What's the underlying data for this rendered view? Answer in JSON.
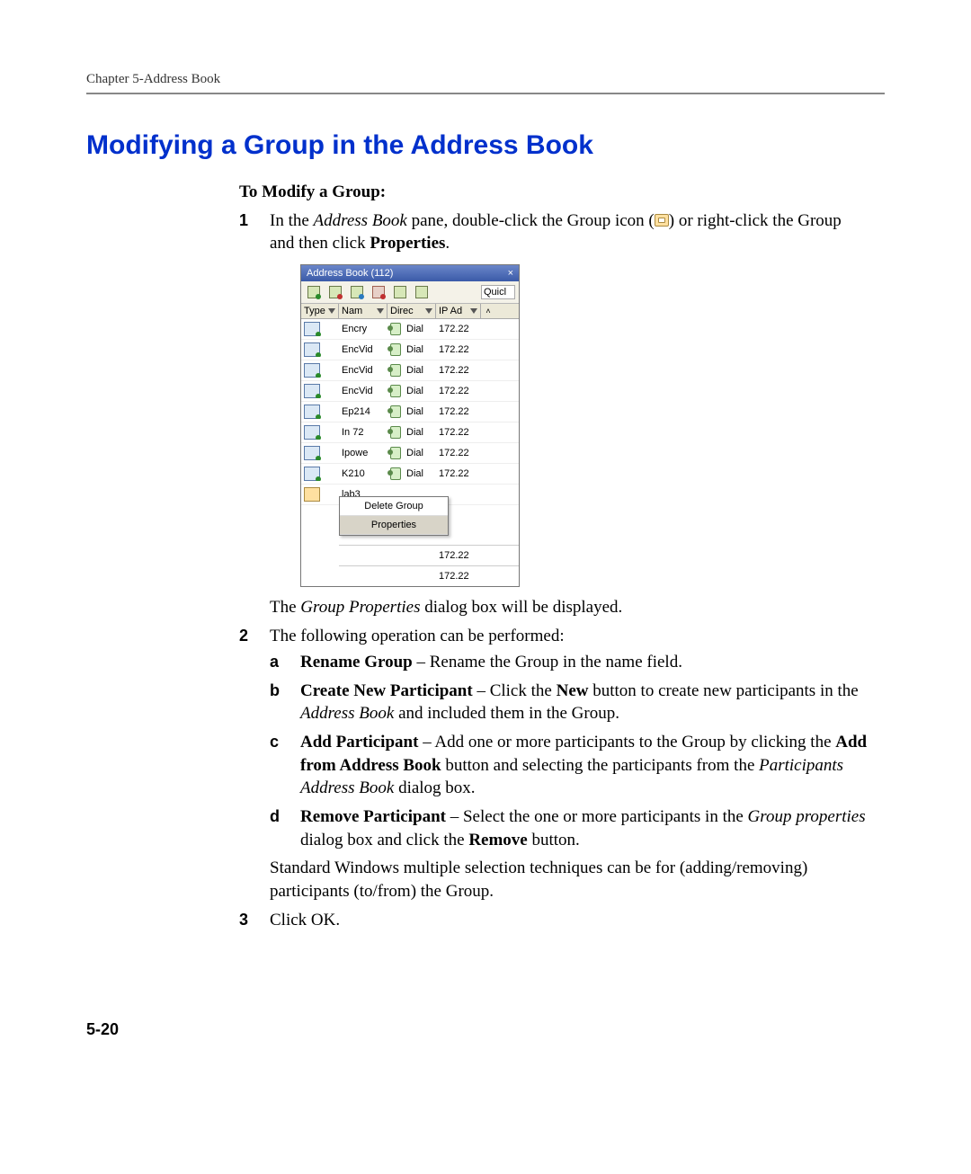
{
  "running_head": "Chapter 5-Address Book",
  "page_number": "5-20",
  "heading": "Modifying a Group in the Address Book",
  "lead_in": "To Modify a Group:",
  "step1": {
    "pre": "In the ",
    "em1": "Address Book",
    "mid1": " pane, double-click the Group icon (",
    "mid2": ") or right-click the Group and then click ",
    "bold1": "Properties",
    "end": "."
  },
  "after_fig1": {
    "pre": "The ",
    "em1": "Group Properties",
    "post": " dialog box will be displayed."
  },
  "step2_intro": "The following operation can be performed:",
  "sub": {
    "a": {
      "b1": "Rename Group",
      "t1": " – Rename the Group in the name field."
    },
    "b": {
      "b1": "Create New Participant",
      "t1": " – Click the ",
      "b2": "New",
      "t2": " button to create new participants in the ",
      "e1": "Address Book",
      "t3": " and included them in the Group."
    },
    "c": {
      "b1": "Add Participant",
      "t1": " – Add one or more participants to the Group by clicking the ",
      "b2": "Add from Address Book",
      "t2": " button and selecting the participants from the ",
      "e1": "Participants Address Book",
      "t3": " dialog box."
    },
    "d": {
      "b1": "Remove Participant",
      "t1": " – Select the one or more participants in the ",
      "e1": "Group properties",
      "t2": " dialog box and click the ",
      "b2": "Remove",
      "t3": " button."
    }
  },
  "std_note": "Standard Windows multiple selection techniques can be for (adding/removing) participants (to/from) the Group.",
  "step3": "Click OK.",
  "panel": {
    "title": "Address Book (112)",
    "close": "×",
    "quick": "Quicl",
    "columns": {
      "c1": "Type",
      "c2": "Nam",
      "c3": "Direc",
      "c4": "IP Ad"
    },
    "scroll_up": "˄",
    "rows": [
      {
        "name": "Encry",
        "dir": "Dial",
        "ip": "172.22",
        "kind": "p"
      },
      {
        "name": "EncVid",
        "dir": "Dial",
        "ip": "172.22",
        "kind": "p"
      },
      {
        "name": "EncVid",
        "dir": "Dial",
        "ip": "172.22",
        "kind": "p"
      },
      {
        "name": "EncVid",
        "dir": "Dial",
        "ip": "172.22",
        "kind": "p"
      },
      {
        "name": "Ep214",
        "dir": "Dial",
        "ip": "172.22",
        "kind": "p"
      },
      {
        "name": "In 72",
        "dir": "Dial",
        "ip": "172.22",
        "kind": "p"
      },
      {
        "name": "Ipowe",
        "dir": "Dial",
        "ip": "172.22",
        "kind": "p"
      },
      {
        "name": "K210",
        "dir": "Dial",
        "ip": "172.22",
        "kind": "p"
      },
      {
        "name": "lab3",
        "dir": "",
        "ip": "",
        "kind": "g"
      }
    ],
    "context_menu": {
      "item1": "Delete Group",
      "item2": "Properties"
    },
    "trail": [
      {
        "ip": "172.22"
      },
      {
        "ip": "172.22"
      }
    ]
  }
}
